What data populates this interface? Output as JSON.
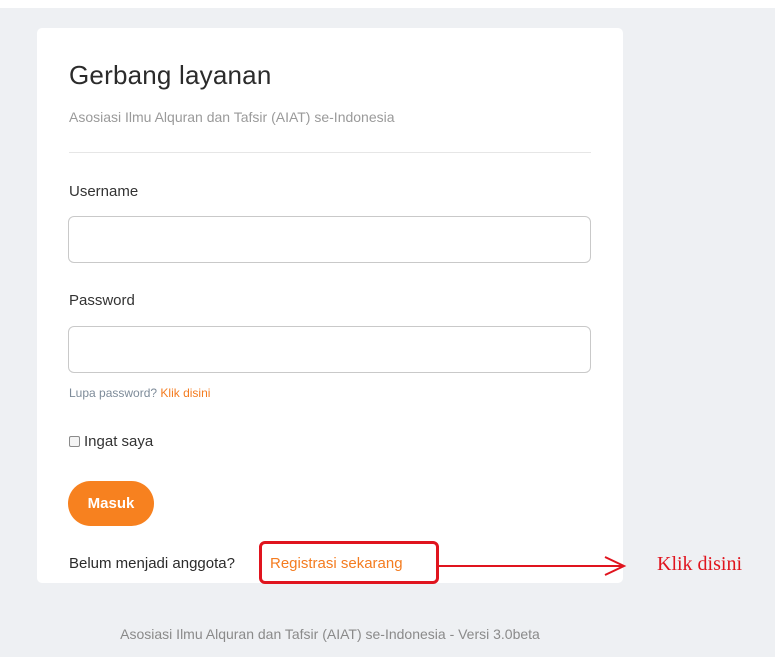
{
  "login": {
    "title": "Gerbang layanan",
    "subtitle": "Asosiasi Ilmu Alquran dan Tafsir (AIAT) se-Indonesia",
    "username_label": "Username",
    "username_value": "",
    "password_label": "Password",
    "password_value": "",
    "forgot_text": "Lupa password?",
    "forgot_link": "Klik disini",
    "remember_label": "Ingat saya",
    "remember_checked": false,
    "submit_label": "Masuk",
    "register_prompt": "Belum menjadi anggota?",
    "register_link": "Registrasi sekarang"
  },
  "annotation": {
    "text": "Klik disini",
    "color": "#e0141e"
  },
  "footer": {
    "text": "Asosiasi Ilmu Alquran dan Tafsir (AIAT) se-Indonesia - Versi 3.0beta"
  },
  "colors": {
    "accent": "#f7811f",
    "background": "#eef0f3",
    "card": "#ffffff"
  }
}
